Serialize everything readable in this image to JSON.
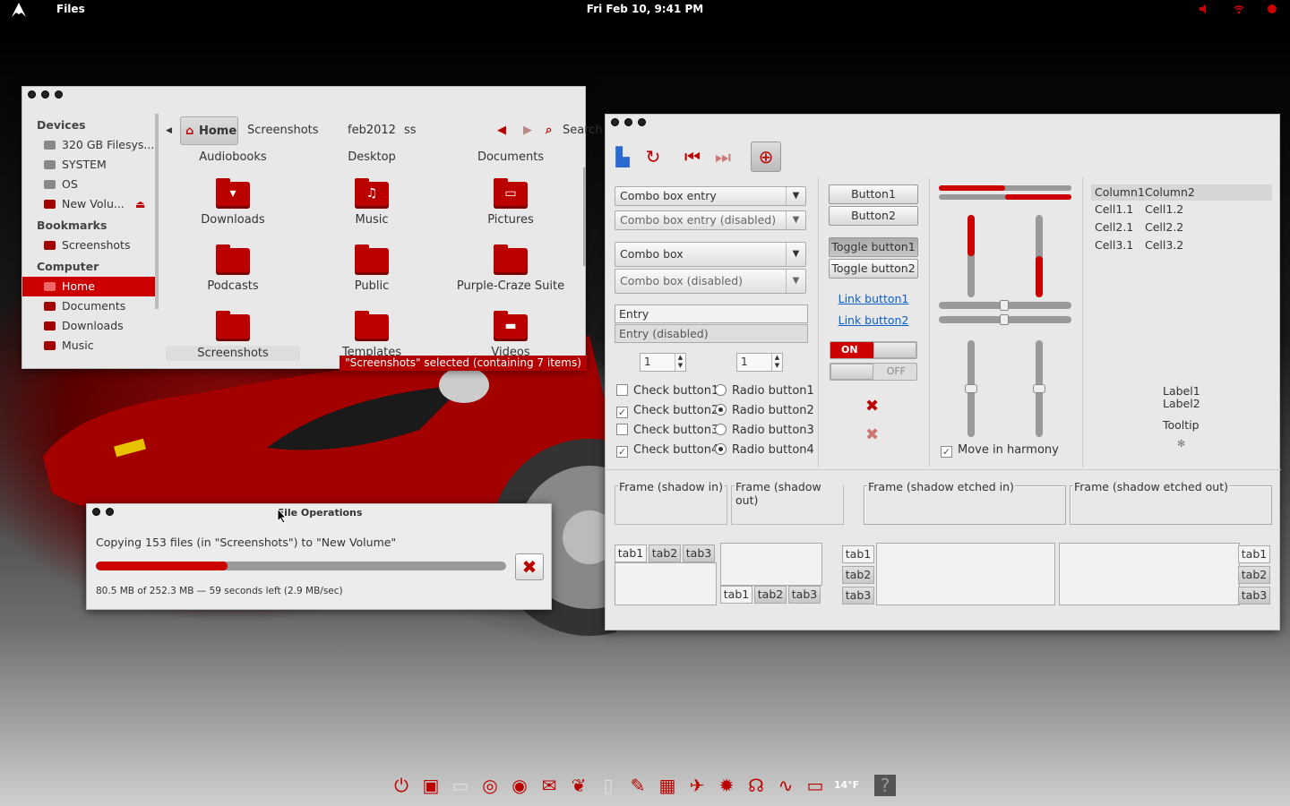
{
  "topbar": {
    "app": "Files",
    "clock": "Fri Feb 10,  9:41 PM"
  },
  "fm": {
    "sidebar": {
      "devices_header": "Devices",
      "devices": [
        "320 GB Filesys...",
        "SYSTEM",
        "OS",
        "New Volu..."
      ],
      "bookmarks_header": "Bookmarks",
      "bookmarks": [
        "Screenshots"
      ],
      "computer_header": "Computer",
      "computer": [
        "Home",
        "Documents",
        "Downloads",
        "Music"
      ]
    },
    "path": [
      "Home",
      "Screenshots",
      "feb2012",
      "ss"
    ],
    "search": "Search",
    "items": [
      "Audiobooks",
      "Desktop",
      "Documents",
      "Downloads",
      "Music",
      "Pictures",
      "Podcasts",
      "Public",
      "Purple-Craze Suite",
      "Screenshots",
      "Templates",
      "Videos"
    ],
    "status": "\"Screenshots\" selected (containing 7 items)"
  },
  "fo": {
    "title": "File Operations",
    "message": "Copying 153 files (in \"Screenshots\") to \"New Volume\"",
    "progress": 0.32,
    "detail": "80.5 MB of 252.3 MB — 59 seconds left (2.9 MB/sec)"
  },
  "wf": {
    "combo_entry": "Combo box entry",
    "combo_entry_dis": "Combo box entry (disabled)",
    "combo": "Combo box",
    "combo_dis": "Combo box (disabled)",
    "entry": "Entry",
    "entry_dis": "Entry (disabled)",
    "spin1": "1",
    "spin2": "1",
    "checks": [
      "Check button1",
      "Check button2",
      "Check button3",
      "Check button4"
    ],
    "checked": [
      false,
      true,
      false,
      true
    ],
    "radios": [
      "Radio button1",
      "Radio button2",
      "Radio button3",
      "Radio button4"
    ],
    "buttons": [
      "Button1",
      "Button2"
    ],
    "toggles": [
      "Toggle button1",
      "Toggle button2"
    ],
    "links": [
      "Link button1",
      "Link button2"
    ],
    "switch_on": "ON",
    "switch_off": "OFF",
    "hsliders": [
      0.5,
      0.5
    ],
    "vsliders": [
      0.5,
      0.5
    ],
    "harmony": "Move in harmony",
    "tree": {
      "columns": [
        "Column1",
        "Column2"
      ],
      "rows": [
        [
          "Cell1.1",
          "Cell1.2"
        ],
        [
          "Cell2.1",
          "Cell2.2"
        ],
        [
          "Cell3.1",
          "Cell3.2"
        ]
      ]
    },
    "label1": "Label1",
    "label2": "Label2",
    "tooltip": "Tooltip",
    "frames": [
      "Frame (shadow in)",
      "Frame (shadow out)",
      "Frame (shadow etched in)",
      "Frame (shadow etched out)"
    ],
    "tabs": [
      "tab1",
      "tab2",
      "tab3"
    ]
  },
  "dock": {
    "weather": "14°F"
  },
  "colors": {
    "accent": "#cc0000",
    "window_bg": "#e8e8e8"
  }
}
